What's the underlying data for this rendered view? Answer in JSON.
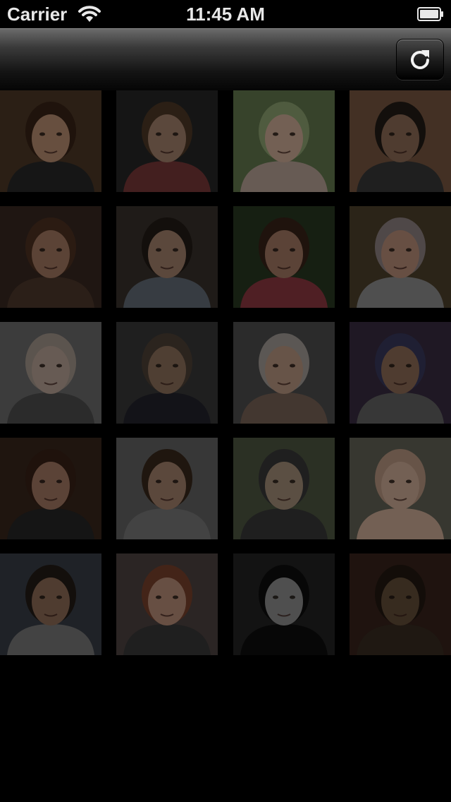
{
  "status_bar": {
    "carrier": "Carrier",
    "time": "11:45 AM",
    "wifi_icon": "wifi-icon",
    "battery_icon": "battery-icon"
  },
  "nav_bar": {
    "refresh_icon": "refresh-icon"
  },
  "photos": [
    {
      "name": "photo-woman-brown-hair",
      "bg": "#3a2a1c",
      "face": "#8a6a55",
      "hair": "#2a1a10",
      "top": "#1e1e1e"
    },
    {
      "name": "photo-man-sunglasses",
      "bg": "#1c1c1c",
      "face": "#7a6050",
      "hair": "#3a2a1c",
      "top": "#5a2a2a"
    },
    {
      "name": "photo-baby-under-blanket",
      "bg": "#4a5a3a",
      "face": "#9a8070",
      "hair": "#6a7a55",
      "top": "#8a7a70"
    },
    {
      "name": "photo-man-beard",
      "bg": "#5a4030",
      "face": "#6a5040",
      "hair": "#1a1410",
      "top": "#2a2a2a"
    },
    {
      "name": "photo-woman-hat",
      "bg": "#2a1e18",
      "face": "#7a5a48",
      "hair": "#3a2418",
      "top": "#3a2a20"
    },
    {
      "name": "photo-man-phone-smiling",
      "bg": "#2a2520",
      "face": "#7a6050",
      "hair": "#1a1410",
      "top": "#4a5058"
    },
    {
      "name": "photo-woman-curly-hair",
      "bg": "#1e2a18",
      "face": "#7a5a4a",
      "hair": "#2a1a12",
      "top": "#6a2a30"
    },
    {
      "name": "photo-old-man-uniform",
      "bg": "#3a3020",
      "face": "#8a6a5a",
      "hair": "#6a6060",
      "top": "#6a6a6a"
    },
    {
      "name": "photo-woman-blonde",
      "bg": "#505050",
      "face": "#8a7a70",
      "hair": "#7a7068",
      "top": "#3a3a3a"
    },
    {
      "name": "photo-man-suit",
      "bg": "#2a2a2a",
      "face": "#6a5445",
      "hair": "#3a3028",
      "top": "#1a1a20"
    },
    {
      "name": "photo-old-woman-glasses",
      "bg": "#3a3a3a",
      "face": "#8a7060",
      "hair": "#7a7570",
      "top": "#5a4a40"
    },
    {
      "name": "photo-old-man-cap",
      "bg": "#2a2030",
      "face": "#6a5040",
      "hair": "#2a2a44",
      "top": "#4a4a4a"
    },
    {
      "name": "photo-man-glasses-pointing",
      "bg": "#2a1c14",
      "face": "#7a5a4a",
      "hair": "#2a1810",
      "top": "#1c1c1c"
    },
    {
      "name": "photo-woman-yawning",
      "bg": "#4a4a4a",
      "face": "#7a6050",
      "hair": "#2a1e14",
      "top": "#5a5a5a"
    },
    {
      "name": "photo-man-sunglasses-closeup",
      "bg": "#3a4030",
      "face": "#7a6a5a",
      "hair": "#2a2a2a",
      "top": "#2a2a2a"
    },
    {
      "name": "photo-baby-smiling",
      "bg": "#4a4a40",
      "face": "#9a8070",
      "hair": "#8a7060",
      "top": "#9a8070"
    },
    {
      "name": "photo-man-tshirt",
      "bg": "#2a2e34",
      "face": "#6a5040",
      "hair": "#1a1410",
      "top": "#5a5a5a"
    },
    {
      "name": "photo-woman-red-hair",
      "bg": "#3a3230",
      "face": "#8a6a5a",
      "hair": "#5a3020",
      "top": "#2a2a2a"
    },
    {
      "name": "photo-man-red-graphic",
      "bg": "#1a1a1a",
      "face": "#6a6a6a",
      "hair": "#0a0a0a",
      "top": "#0a0a0a"
    },
    {
      "name": "photo-man-dark-background",
      "bg": "#2a1a14",
      "face": "#4a3a2a",
      "hair": "#1a120c",
      "top": "#2a2018"
    }
  ]
}
